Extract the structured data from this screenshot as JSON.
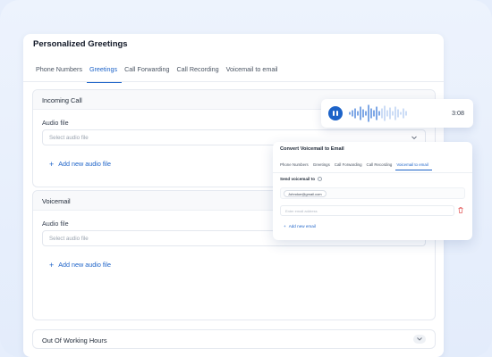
{
  "panel": {
    "title": "Personalized Greetings",
    "tabs": [
      {
        "label": "Phone Numbers",
        "active": false
      },
      {
        "label": "Greetings",
        "active": true
      },
      {
        "label": "Call Forwarding",
        "active": false
      },
      {
        "label": "Call Recording",
        "active": false
      },
      {
        "label": "Voicemail to email",
        "active": false
      }
    ]
  },
  "sections": {
    "incoming": {
      "title": "Incoming Call",
      "audio_label": "Audio file",
      "select_placeholder": "Select audio file",
      "add_label": "Add new audio file"
    },
    "voicemail": {
      "title": "Voicemail",
      "audio_label": "Audio file",
      "select_placeholder": "Select audio file",
      "add_label": "Add new audio file"
    },
    "out_of_hours": {
      "title": "Out Of Working Hours"
    }
  },
  "player": {
    "duration": "3:08",
    "icon": "pause-icon"
  },
  "voicemail_card": {
    "title": "Convert Voicemail to Email",
    "tabs": [
      {
        "label": "Phone Numbers",
        "active": false
      },
      {
        "label": "Greetings",
        "active": false
      },
      {
        "label": "Call Forwarding",
        "active": false
      },
      {
        "label": "Call Recording",
        "active": false
      },
      {
        "label": "Voicemail to email",
        "active": true
      }
    ],
    "send_label": "Send voicemail to",
    "email_chip": "Johndoe@gmail.com",
    "email_placeholder": "Enter email address",
    "add_label": "Add new email"
  },
  "colors": {
    "accent": "#1d63c8",
    "danger": "#e25555",
    "background": "#e6eefc"
  }
}
